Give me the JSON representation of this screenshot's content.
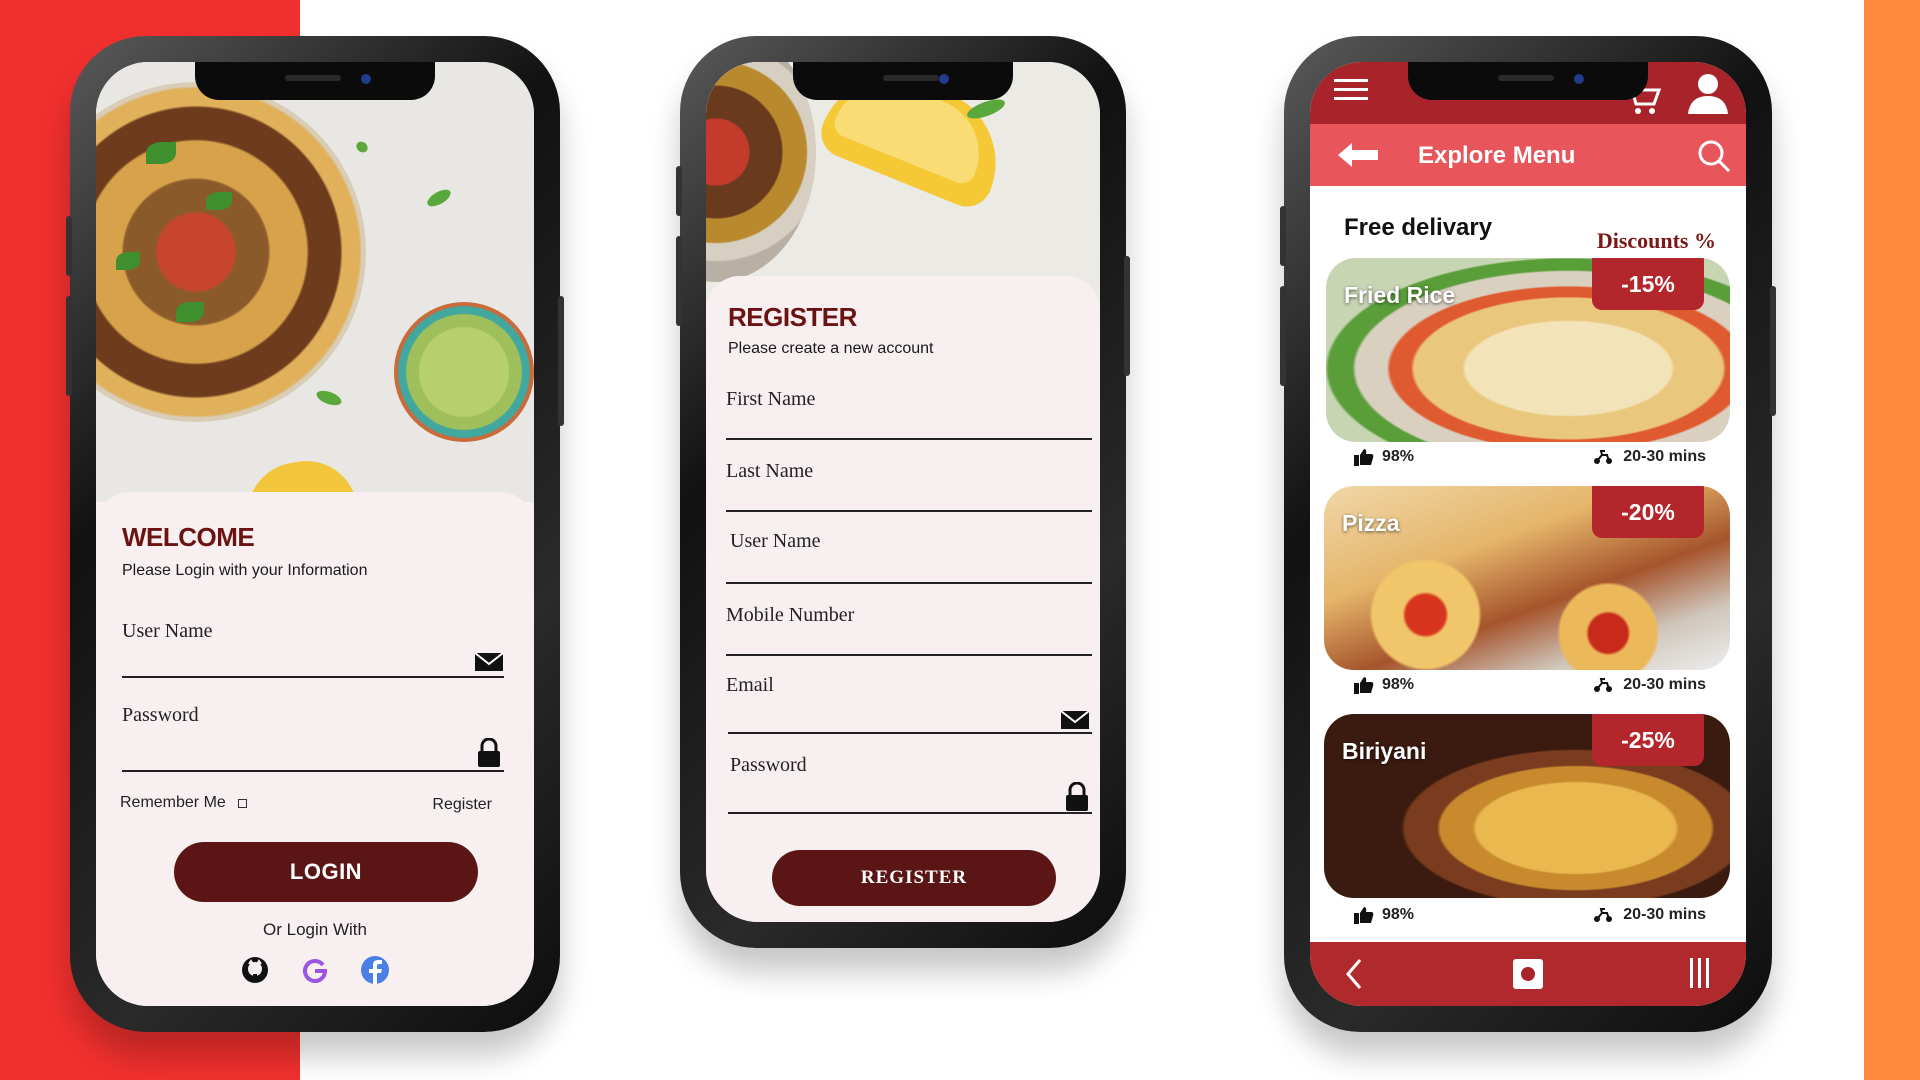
{
  "login": {
    "title": "WELCOME",
    "subtitle": "Please Login with your Information",
    "username_label": "User Name",
    "password_label": "Password",
    "remember_label": "Remember Me",
    "register_link": "Register",
    "login_button": "LOGIN",
    "or_login_with": "Or Login With",
    "socials": [
      "github-icon",
      "google-icon",
      "facebook-icon"
    ]
  },
  "register": {
    "title": "REGISTER",
    "subtitle": "Please create a new account",
    "fields": [
      "First Name",
      "Last Name",
      "User Name",
      "Mobile Number",
      "Email",
      "Password"
    ],
    "register_button": "REGISTER"
  },
  "menu": {
    "header_title": "Explore Menu",
    "free_delivery": "Free delivary",
    "discounts_label": "Discounts %",
    "items": [
      {
        "name": "Fried Rice",
        "discount": "-15%",
        "rating": "98%",
        "time": "20-30 mins"
      },
      {
        "name": "Pizza",
        "discount": "-20%",
        "rating": "98%",
        "time": "20-30 mins"
      },
      {
        "name": "Biriyani",
        "discount": "-25%",
        "rating": "98%",
        "time": "20-30 mins"
      }
    ]
  },
  "colors": {
    "brand_dark": "#5b1515",
    "brand_red": "#a8242a",
    "accent_red": "#e8565b",
    "background_left": "#f0302e",
    "background_right": "#ff8a3d"
  }
}
